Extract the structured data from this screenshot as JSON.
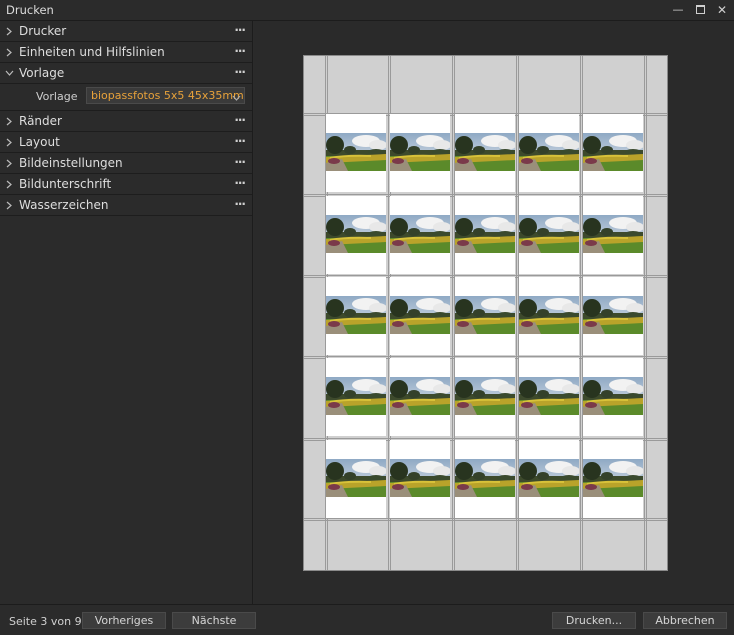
{
  "window": {
    "title": "Drucken",
    "controls": [
      "minimize-icon",
      "maximize-icon",
      "close-icon"
    ]
  },
  "sidebar": {
    "sections": [
      {
        "label": "Drucker",
        "expanded": false
      },
      {
        "label": "Einheiten und Hilfslinien",
        "expanded": false
      },
      {
        "label": "Vorlage",
        "expanded": true
      },
      {
        "label": "Ränder",
        "expanded": false
      },
      {
        "label": "Layout",
        "expanded": false
      },
      {
        "label": "Bildeinstellungen",
        "expanded": false
      },
      {
        "label": "Bildunterschrift",
        "expanded": false
      },
      {
        "label": "Wasserzeichen",
        "expanded": false
      }
    ],
    "menu_glyph": "···",
    "vorlage": {
      "field_label": "Vorlage",
      "value": "biopassfotos 5x5 45x35mm"
    }
  },
  "preview": {
    "rows": 5,
    "cols": 5,
    "accent_color": "#e8a23a"
  },
  "footer": {
    "page_status": "Seite 3 von 9",
    "prev_label": "Vorheriges",
    "next_label": "Nächste",
    "print_label": "Drucken...",
    "cancel_label": "Abbrechen"
  }
}
